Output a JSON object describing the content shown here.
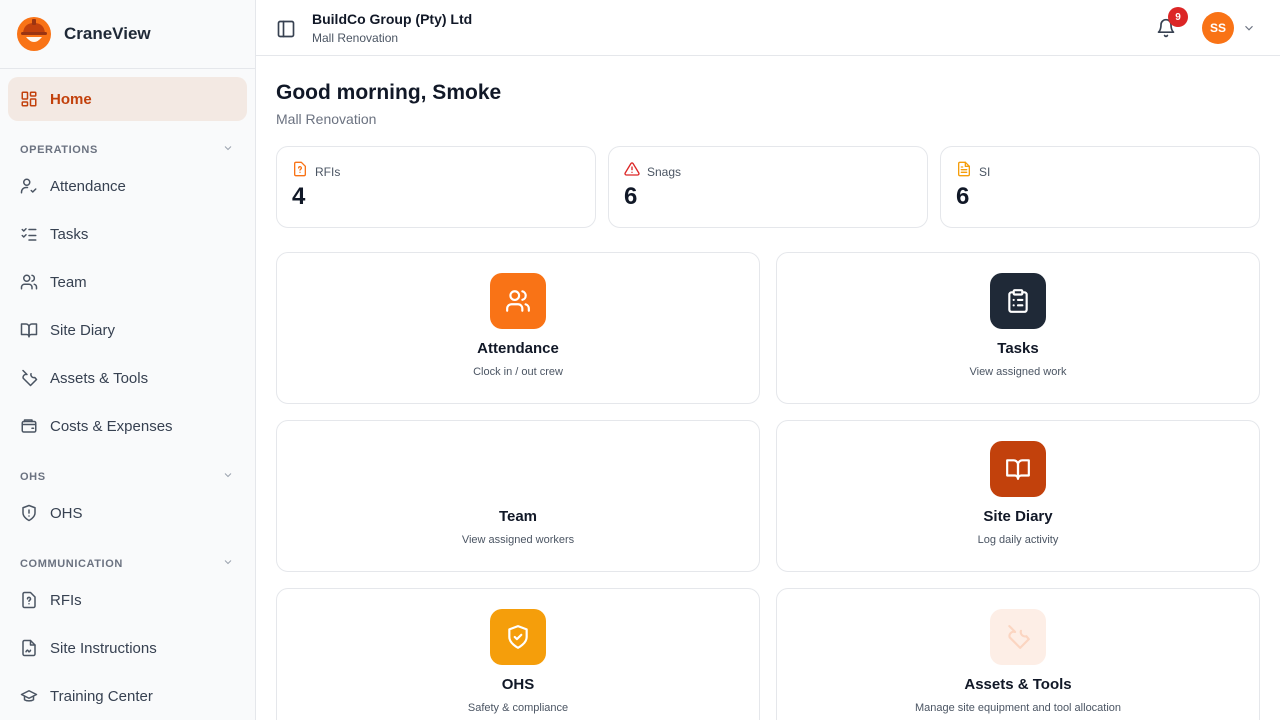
{
  "brand": {
    "name": "CraneView",
    "accent": "#f97316"
  },
  "sidebar": {
    "home": {
      "label": "Home",
      "icon": "dashboard-icon"
    },
    "sections": [
      {
        "label": "OPERATIONS",
        "items": [
          {
            "label": "Attendance",
            "icon": "user-check-icon"
          },
          {
            "label": "Tasks",
            "icon": "list-checks-icon"
          },
          {
            "label": "Team",
            "icon": "users-icon"
          },
          {
            "label": "Site Diary",
            "icon": "book-open-icon"
          },
          {
            "label": "Assets & Tools",
            "icon": "wrench-icon"
          },
          {
            "label": "Costs & Expenses",
            "icon": "wallet-icon"
          }
        ]
      },
      {
        "label": "OHS",
        "items": [
          {
            "label": "OHS",
            "icon": "shield-icon"
          }
        ]
      },
      {
        "label": "COMMUNICATION",
        "items": [
          {
            "label": "RFIs",
            "icon": "file-question-icon"
          },
          {
            "label": "Site Instructions",
            "icon": "file-signature-icon"
          },
          {
            "label": "Training Center",
            "icon": "graduation-cap-icon"
          }
        ]
      }
    ]
  },
  "header": {
    "org_name": "BuildCo Group (Pty) Ltd",
    "project": "Mall Renovation",
    "notifications_count": "9",
    "avatar_initials": "SS"
  },
  "main": {
    "greeting": "Good morning, Smoke",
    "subtitle": "Mall Renovation",
    "stats": [
      {
        "label": "RFIs",
        "value": "4",
        "icon": "file-question-icon",
        "color": "#f97316"
      },
      {
        "label": "Snags",
        "value": "6",
        "icon": "alert-triangle-icon",
        "color": "#dc2626"
      },
      {
        "label": "SI",
        "value": "6",
        "icon": "file-text-icon",
        "color": "#f59e0b"
      }
    ],
    "cards": [
      {
        "title": "Attendance",
        "desc": "Clock in / out crew",
        "icon": "users-icon",
        "color": "#f97316"
      },
      {
        "title": "Tasks",
        "desc": "View assigned work",
        "icon": "clipboard-list-icon",
        "color": "#1f2937"
      },
      {
        "title": "Team",
        "desc": "View assigned workers",
        "icon": "team-icon",
        "color": "#ffffff"
      },
      {
        "title": "Site Diary",
        "desc": "Log daily activity",
        "icon": "book-open-icon",
        "color": "#c2410c"
      },
      {
        "title": "OHS",
        "desc": "Safety & compliance",
        "icon": "shield-check-icon",
        "color": "#f59e0b"
      },
      {
        "title": "Assets & Tools",
        "desc": "Manage site equipment and tool allocation",
        "icon": "wrench-icon",
        "color": "#fdeee6"
      }
    ]
  }
}
